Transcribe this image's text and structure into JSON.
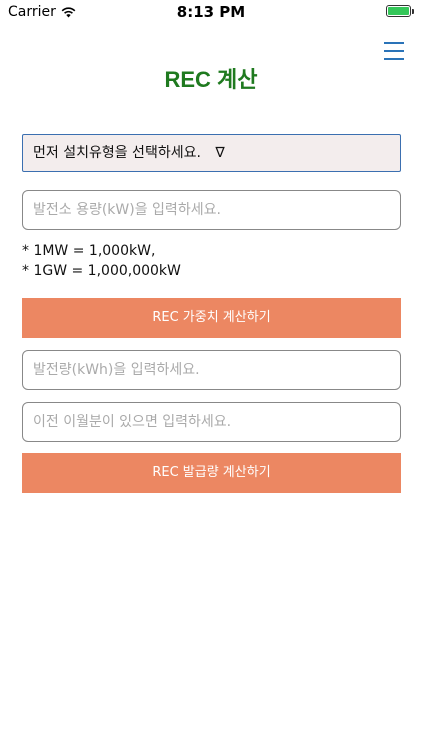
{
  "status_bar": {
    "carrier": "Carrier",
    "time": "8:13 PM",
    "battery_level": 1.0
  },
  "header": {
    "title": "REC 계산",
    "menu_icon": "hamburger-menu-icon"
  },
  "form": {
    "install_type_select": {
      "value": "먼저 설치유형을 선택하세요.",
      "arrow": "∇"
    },
    "capacity_input": {
      "placeholder": "발전소 용량(kW)을 입력하세요."
    },
    "notes": [
      "* 1MW = 1,000kW,",
      "* 1GW = 1,000,000kW"
    ],
    "weight_button_label": "REC 가중치 계산하기",
    "generation_input": {
      "placeholder": "발전량(kWh)을 입력하세요."
    },
    "carryover_input": {
      "placeholder": "이전 이월분이 있으면 입력하세요."
    },
    "issuance_button_label": "REC 발급량 계산하기"
  },
  "colors": {
    "title": "#1f7a1f",
    "button": "#ec8762",
    "menu": "#2a73b8",
    "select_border": "#3b6fb0"
  }
}
